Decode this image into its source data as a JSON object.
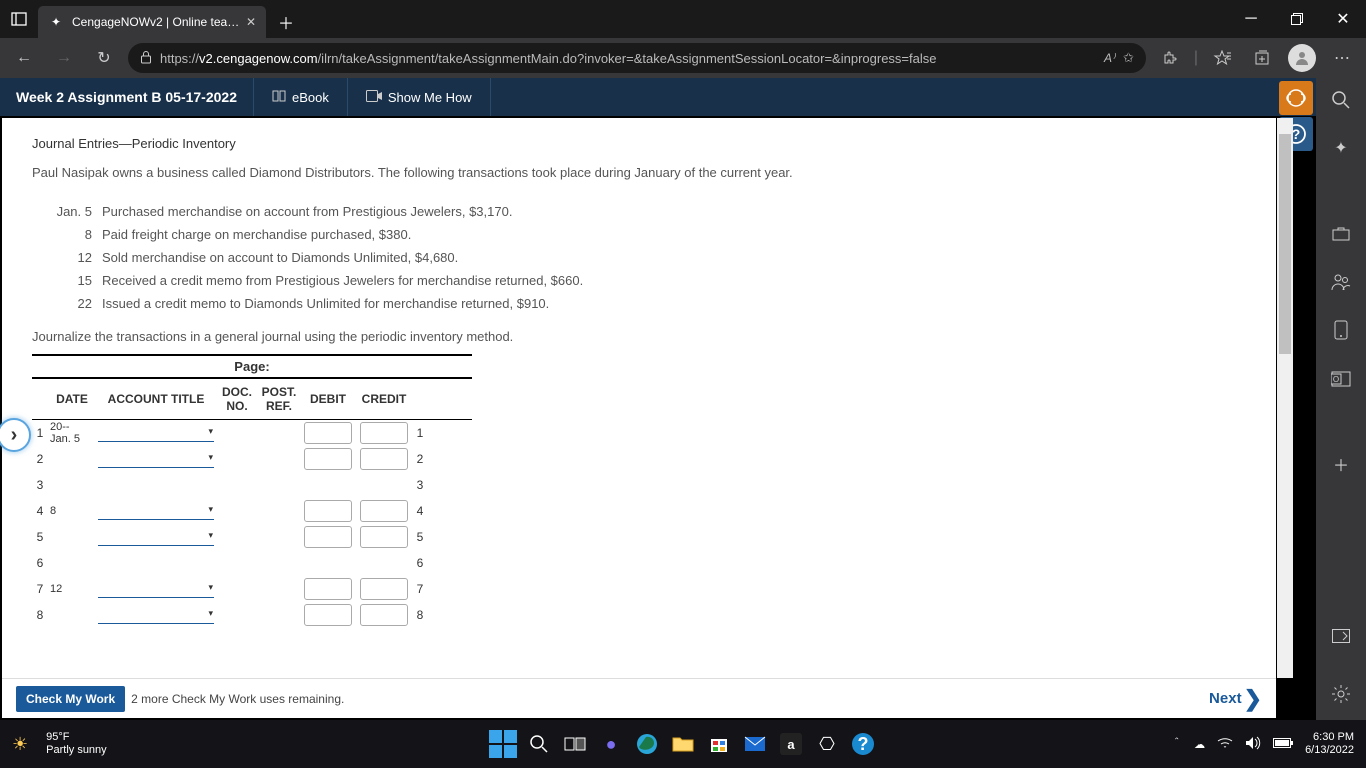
{
  "browser": {
    "tab_title": "CengageNOWv2 | Online teachin",
    "url_prefix": "https://",
    "url_host": "v2.cengagenow.com",
    "url_path": "/ilrn/takeAssignment/takeAssignmentMain.do?invoker=&takeAssignmentSessionLocator=&inprogress=false"
  },
  "header": {
    "assignment_title": "Week 2 Assignment B 05-17-2022",
    "ebook": "eBook",
    "show_me_how": "Show Me How"
  },
  "problem": {
    "title": "Journal Entries—Periodic Inventory",
    "intro": "Paul Nasipak owns a business called Diamond Distributors. The following transactions took place during January of the current year.",
    "transactions": [
      {
        "date": "Jan.  5",
        "desc": "Purchased merchandise on account from Prestigious Jewelers, $3,170."
      },
      {
        "date": "8",
        "desc": "Paid freight charge on merchandise purchased, $380."
      },
      {
        "date": "12",
        "desc": "Sold merchandise on account to Diamonds Unlimited, $4,680."
      },
      {
        "date": "15",
        "desc": "Received a credit memo from Prestigious Jewelers for merchandise returned, $660."
      },
      {
        "date": "22",
        "desc": "Issued a credit memo to Diamonds Unlimited for merchandise returned, $910."
      }
    ],
    "instruction": "Journalize the transactions in a general journal using the periodic inventory method."
  },
  "journal": {
    "page_label": "Page:",
    "headers": {
      "date": "DATE",
      "acct": "ACCOUNT TITLE",
      "doc": "DOC. NO.",
      "post": "POST. REF.",
      "debit": "DEBIT",
      "credit": "CREDIT"
    },
    "rows": [
      {
        "n": "1",
        "date_top": "20--",
        "date_bot": "Jan. 5",
        "acct": true,
        "amt": true
      },
      {
        "n": "2",
        "date_top": "",
        "date_bot": "",
        "acct": true,
        "amt": true
      },
      {
        "n": "3",
        "date_top": "",
        "date_bot": "",
        "acct": false,
        "amt": false
      },
      {
        "n": "4",
        "date_top": "",
        "date_bot": "8",
        "acct": true,
        "amt": true
      },
      {
        "n": "5",
        "date_top": "",
        "date_bot": "",
        "acct": true,
        "amt": true
      },
      {
        "n": "6",
        "date_top": "",
        "date_bot": "",
        "acct": false,
        "amt": false
      },
      {
        "n": "7",
        "date_top": "",
        "date_bot": "12",
        "acct": true,
        "amt": true
      },
      {
        "n": "8",
        "date_top": "",
        "date_bot": "",
        "acct": true,
        "amt": true
      }
    ]
  },
  "footer": {
    "check_label": "Check My Work",
    "remaining": "2 more Check My Work uses remaining.",
    "next": "Next"
  },
  "system": {
    "temp": "95°F",
    "cond": "Partly sunny",
    "time": "6:30 PM",
    "date": "6/13/2022"
  }
}
